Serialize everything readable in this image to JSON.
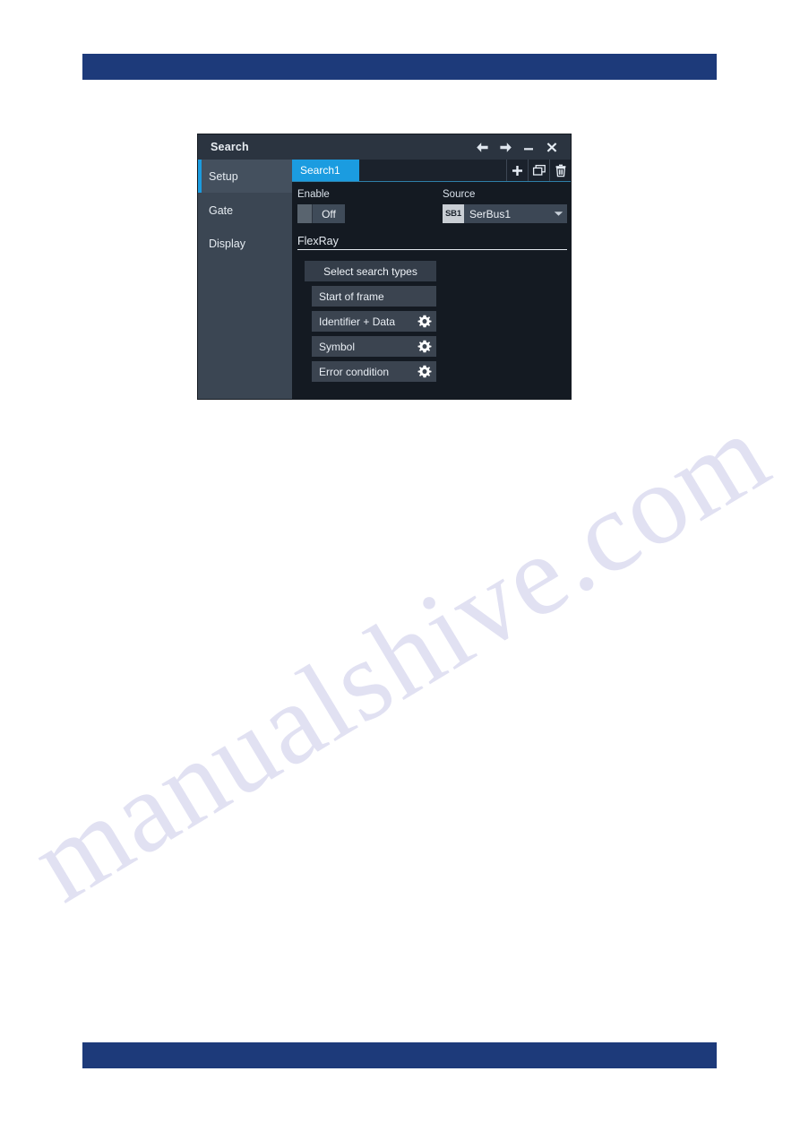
{
  "page": {
    "watermark_text": "manualshive.com",
    "rule_color": "#1d3a7a"
  },
  "dialog": {
    "title": "Search",
    "titlebar_buttons": [
      {
        "name": "back-arrow-icon",
        "label": "←"
      },
      {
        "name": "forward-arrow-icon",
        "label": "→"
      },
      {
        "name": "minimize-icon",
        "label": "–"
      },
      {
        "name": "close-icon",
        "label": "✕"
      }
    ],
    "sidebar": {
      "items": [
        {
          "label": "Setup",
          "active": true
        },
        {
          "label": "Gate",
          "active": false
        },
        {
          "label": "Display",
          "active": false
        }
      ],
      "accent_color": "#1b9ce0"
    },
    "tabbar": {
      "tabs": [
        {
          "label": "Search1",
          "active": true
        }
      ],
      "actions": [
        {
          "name": "add-icon",
          "label": "+"
        },
        {
          "name": "duplicate-window-icon",
          "label": "❐"
        },
        {
          "name": "delete-trash-icon",
          "label": "🗑"
        }
      ],
      "active_tab_color": "#1b9ce0"
    },
    "setup": {
      "enable_label": "Enable",
      "enable_value": "Off",
      "source_label": "Source",
      "source_badge": "SB1",
      "source_value": "SerBus1",
      "protocol": "FlexRay",
      "select_search_types_label": "Select search types",
      "search_types": [
        {
          "label": "Start of frame",
          "has_settings": false
        },
        {
          "label": "Identifier + Data",
          "has_settings": true
        },
        {
          "label": "Symbol",
          "has_settings": true
        },
        {
          "label": "Error condition",
          "has_settings": true
        }
      ]
    }
  }
}
